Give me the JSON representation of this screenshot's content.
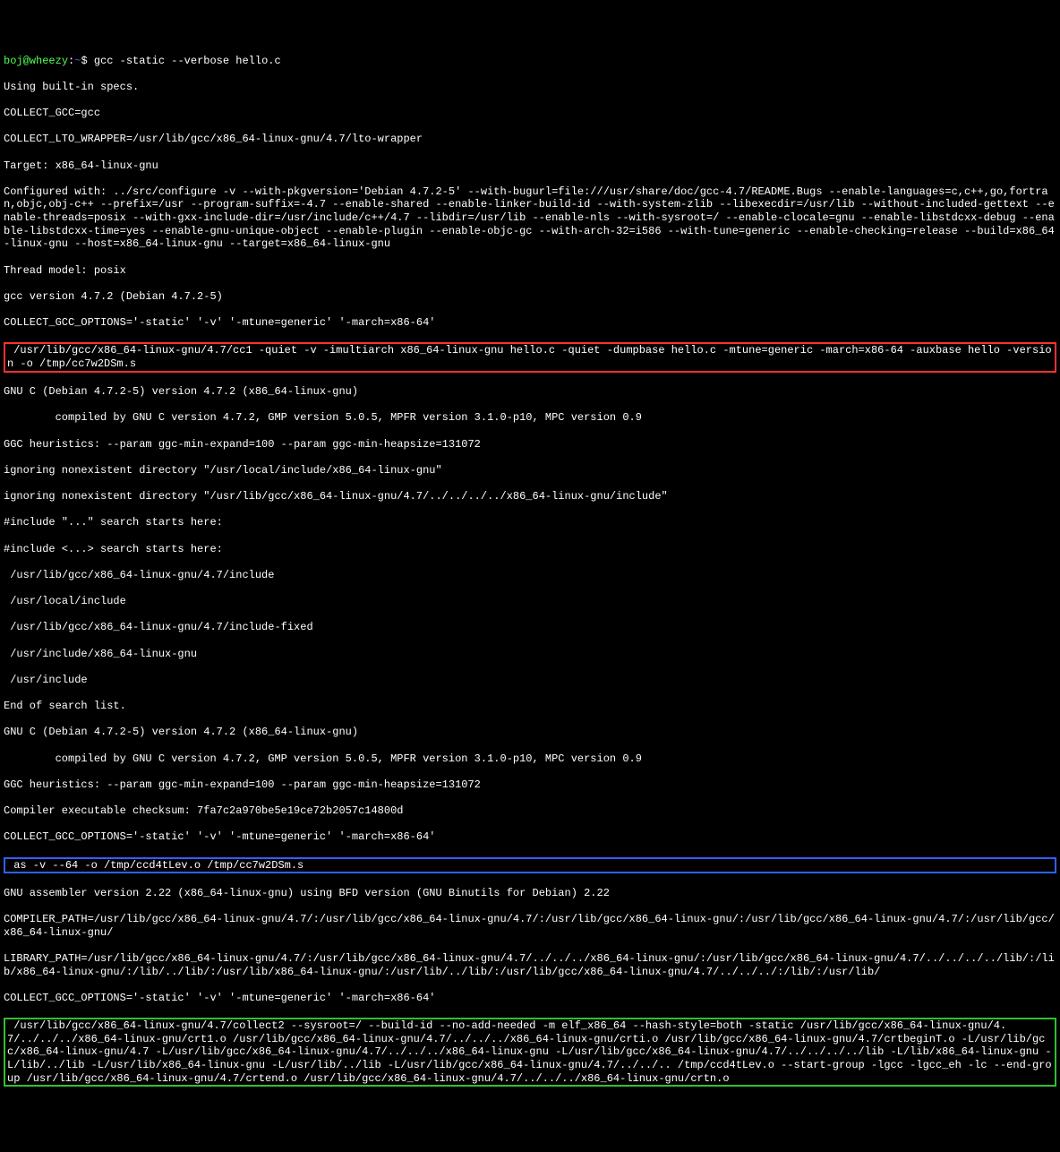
{
  "prompt": {
    "user": "boj",
    "host": "wheezy",
    "path": "~",
    "symbol": "$"
  },
  "command": "gcc -static --verbose hello.c",
  "lines": {
    "l01": "Using built-in specs.",
    "l02": "COLLECT_GCC=gcc",
    "l03": "COLLECT_LTO_WRAPPER=/usr/lib/gcc/x86_64-linux-gnu/4.7/lto-wrapper",
    "l04": "Target: x86_64-linux-gnu",
    "l05": "Configured with: ../src/configure -v --with-pkgversion='Debian 4.7.2-5' --with-bugurl=file:///usr/share/doc/gcc-4.7/README.Bugs --enable-languages=c,c++,go,fortran,objc,obj-c++ --prefix=/usr --program-suffix=-4.7 --enable-shared --enable-linker-build-id --with-system-zlib --libexecdir=/usr/lib --without-included-gettext --enable-threads=posix --with-gxx-include-dir=/usr/include/c++/4.7 --libdir=/usr/lib --enable-nls --with-sysroot=/ --enable-clocale=gnu --enable-libstdcxx-debug --enable-libstdcxx-time=yes --enable-gnu-unique-object --enable-plugin --enable-objc-gc --with-arch-32=i586 --with-tune=generic --enable-checking=release --build=x86_64-linux-gnu --host=x86_64-linux-gnu --target=x86_64-linux-gnu",
    "l06": "Thread model: posix",
    "l07": "gcc version 4.7.2 (Debian 4.7.2-5)",
    "l08": "COLLECT_GCC_OPTIONS='-static' '-v' '-mtune=generic' '-march=x86-64'",
    "box1": " /usr/lib/gcc/x86_64-linux-gnu/4.7/cc1 -quiet -v -imultiarch x86_64-linux-gnu hello.c -quiet -dumpbase hello.c -mtune=generic -march=x86-64 -auxbase hello -version -o /tmp/cc7w2DSm.s",
    "l09": "GNU C (Debian 4.7.2-5) version 4.7.2 (x86_64-linux-gnu)",
    "l10": "        compiled by GNU C version 4.7.2, GMP version 5.0.5, MPFR version 3.1.0-p10, MPC version 0.9",
    "l11": "GGC heuristics: --param ggc-min-expand=100 --param ggc-min-heapsize=131072",
    "l12": "ignoring nonexistent directory \"/usr/local/include/x86_64-linux-gnu\"",
    "l13": "ignoring nonexistent directory \"/usr/lib/gcc/x86_64-linux-gnu/4.7/../../../../x86_64-linux-gnu/include\"",
    "l14": "#include \"...\" search starts here:",
    "l15": "#include <...> search starts here:",
    "l16": " /usr/lib/gcc/x86_64-linux-gnu/4.7/include",
    "l17": " /usr/local/include",
    "l18": " /usr/lib/gcc/x86_64-linux-gnu/4.7/include-fixed",
    "l19": " /usr/include/x86_64-linux-gnu",
    "l20": " /usr/include",
    "l21": "End of search list.",
    "l22": "GNU C (Debian 4.7.2-5) version 4.7.2 (x86_64-linux-gnu)",
    "l23": "        compiled by GNU C version 4.7.2, GMP version 5.0.5, MPFR version 3.1.0-p10, MPC version 0.9",
    "l24": "GGC heuristics: --param ggc-min-expand=100 --param ggc-min-heapsize=131072",
    "l25": "Compiler executable checksum: 7fa7c2a970be5e19ce72b2057c14800d",
    "l26": "COLLECT_GCC_OPTIONS='-static' '-v' '-mtune=generic' '-march=x86-64'",
    "box2": " as -v --64 -o /tmp/ccd4tLev.o /tmp/cc7w2DSm.s",
    "l27": "GNU assembler version 2.22 (x86_64-linux-gnu) using BFD version (GNU Binutils for Debian) 2.22",
    "l28": "COMPILER_PATH=/usr/lib/gcc/x86_64-linux-gnu/4.7/:/usr/lib/gcc/x86_64-linux-gnu/4.7/:/usr/lib/gcc/x86_64-linux-gnu/:/usr/lib/gcc/x86_64-linux-gnu/4.7/:/usr/lib/gcc/x86_64-linux-gnu/",
    "l29": "LIBRARY_PATH=/usr/lib/gcc/x86_64-linux-gnu/4.7/:/usr/lib/gcc/x86_64-linux-gnu/4.7/../../../x86_64-linux-gnu/:/usr/lib/gcc/x86_64-linux-gnu/4.7/../../../../lib/:/lib/x86_64-linux-gnu/:/lib/../lib/:/usr/lib/x86_64-linux-gnu/:/usr/lib/../lib/:/usr/lib/gcc/x86_64-linux-gnu/4.7/../../../:/lib/:/usr/lib/",
    "l30": "COLLECT_GCC_OPTIONS='-static' '-v' '-mtune=generic' '-march=x86-64'",
    "box3": " /usr/lib/gcc/x86_64-linux-gnu/4.7/collect2 --sysroot=/ --build-id --no-add-needed -m elf_x86_64 --hash-style=both -static /usr/lib/gcc/x86_64-linux-gnu/4.7/../../../x86_64-linux-gnu/crt1.o /usr/lib/gcc/x86_64-linux-gnu/4.7/../../../x86_64-linux-gnu/crti.o /usr/lib/gcc/x86_64-linux-gnu/4.7/crtbeginT.o -L/usr/lib/gcc/x86_64-linux-gnu/4.7 -L/usr/lib/gcc/x86_64-linux-gnu/4.7/../../../x86_64-linux-gnu -L/usr/lib/gcc/x86_64-linux-gnu/4.7/../../../../lib -L/lib/x86_64-linux-gnu -L/lib/../lib -L/usr/lib/x86_64-linux-gnu -L/usr/lib/../lib -L/usr/lib/gcc/x86_64-linux-gnu/4.7/../../.. /tmp/ccd4tLev.o --start-group -lgcc -lgcc_eh -lc --end-group /usr/lib/gcc/x86_64-linux-gnu/4.7/crtend.o /usr/lib/gcc/x86_64-linux-gnu/4.7/../../../x86_64-linux-gnu/crtn.o"
  }
}
